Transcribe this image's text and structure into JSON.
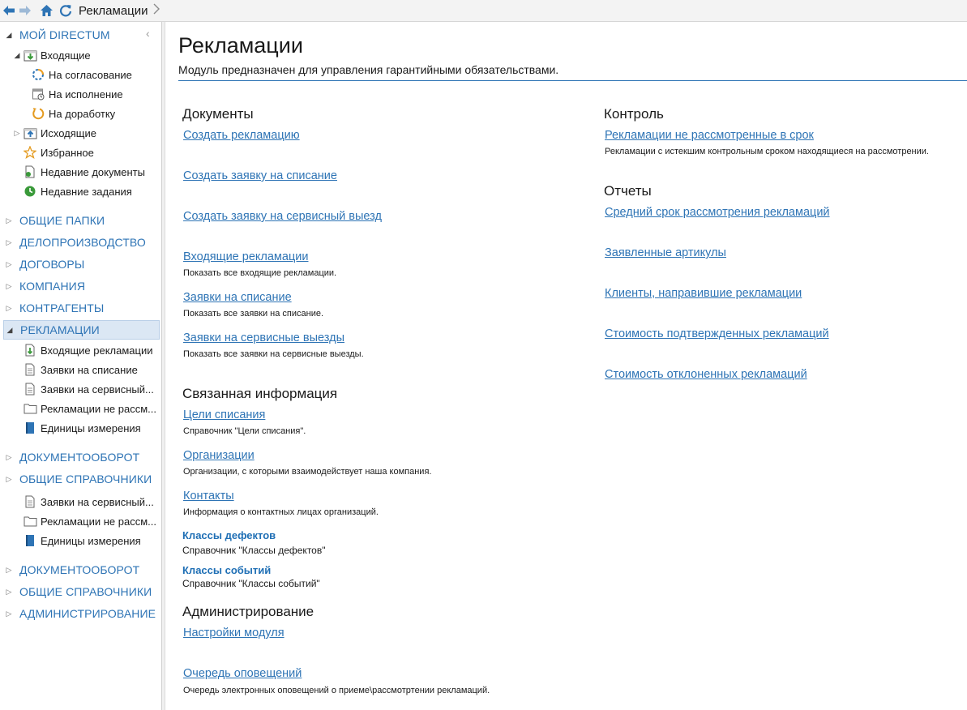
{
  "topbar": {
    "breadcrumb": "Рекламации",
    "icons": [
      "back-arrow-icon",
      "forward-arrow-icon",
      "home-icon",
      "refresh-icon",
      "chevron-right-icon"
    ]
  },
  "colors": {
    "accent": "#2e74b5",
    "selected_bg": "#dbe7f4"
  },
  "sidebar": {
    "my_directum": "МОЙ DIRECTUM",
    "inbox": "Входящие",
    "inbox_items": [
      "На согласование",
      "На исполнение",
      "На доработку"
    ],
    "outbox": "Исходящие",
    "favorites": "Избранное",
    "recent_docs": "Недавние документы",
    "recent_tasks": "Недавние задания",
    "sections1": [
      "ОБЩИЕ ПАПКИ",
      "ДЕЛОПРОИЗВОДСТВО",
      "ДОГОВОРЫ",
      "КОМПАНИЯ",
      "КОНТРАГЕНТЫ"
    ],
    "reclamations": "РЕКЛАМАЦИИ",
    "recl_items": [
      "Входящие рекламации",
      "Заявки на списание",
      "Заявки на сервисный...",
      "Рекламации не рассм...",
      "Единицы измерения"
    ],
    "sections2": [
      "ДОКУМЕНТООБОРОТ",
      "ОБЩИЕ СПРАВОЧНИКИ"
    ],
    "ref_items": [
      "Заявки на сервисный...",
      "Рекламации не рассм...",
      "Единицы измерения"
    ],
    "sections3": [
      "ДОКУМЕНТООБОРОТ",
      "ОБЩИЕ СПРАВОЧНИКИ",
      "АДМИНИСТРИРОВАНИЕ"
    ]
  },
  "main": {
    "title": "Рекламации",
    "description": "Модуль предназначен для управления гарантийными обязательствами.",
    "documents": {
      "heading": "Документы",
      "create_recl": "Создать рекламацию",
      "create_writeoff": "Создать заявку на списание",
      "create_service": "Создать заявку на сервисный выезд",
      "incoming": "Входящие рекламации",
      "incoming_desc": "Показать все входящие рекламации.",
      "writeoffs": "Заявки на списание",
      "writeoffs_desc": "Показать все заявки на списание.",
      "service": "Заявки на сервисные выезды",
      "service_desc": "Показать все заявки на сервисные выезды."
    },
    "related": {
      "heading": "Связанная информация",
      "goals": "Цели списания",
      "goals_desc": "Справочник \"Цели списания\".",
      "orgs": "Организации",
      "orgs_desc": "Организации, с которыми взаимодействует наша компания.",
      "contacts": "Контакты",
      "contacts_desc": "Информация о контактных лицах организаций.",
      "defects": "Классы дефектов",
      "defects_desc": "Справочник \"Классы дефектов\"",
      "events": "Классы событий",
      "events_desc": "Справочник \"Классы событий\""
    },
    "admin": {
      "heading": "Администрирование",
      "settings": "Настройки модуля",
      "queue": "Очередь оповещений",
      "queue_desc": "Очередь электронных оповещений о приеме\\рассмотртении рекламаций."
    },
    "control": {
      "heading": "Контроль",
      "overdue": "Рекламации не рассмотренные в срок",
      "overdue_desc": "Рекламации с истекшим контрольным сроком находящиеся на рассмотрении."
    },
    "reports": {
      "heading": "Отчеты",
      "avg_time": "Средний срок рассмотрения рекламаций",
      "articles": "Заявленные артикулы",
      "clients": "Клиенты, направившие рекламации",
      "cost_confirmed": "Стоимость подтвержденных рекламаций",
      "cost_rejected": "Стоимость отклоненных рекламаций"
    }
  }
}
